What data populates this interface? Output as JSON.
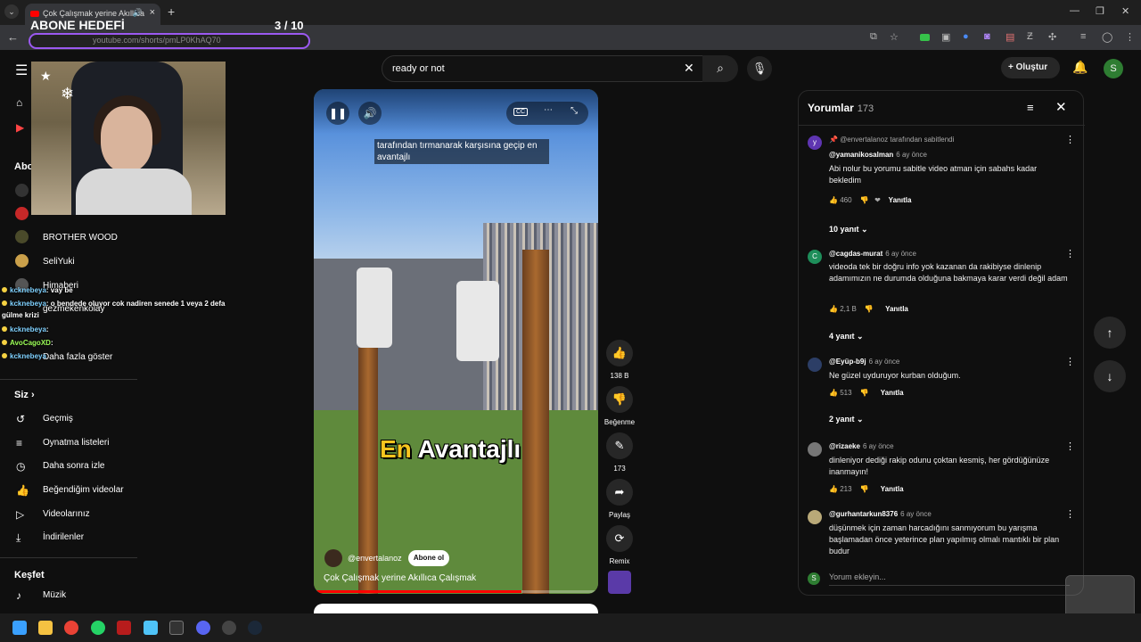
{
  "browser": {
    "tab_title": "Çok Çalışmak yerine Akıllıca",
    "url": "youtube.com/shorts/pmLP0KhAQ70",
    "new_tab": "+"
  },
  "overlay": {
    "title": "ABONE HEDEFİ",
    "count": "3  / 10"
  },
  "header": {
    "search_value": "ready or not",
    "create_label": "Oluştur",
    "avatar_letter": "S"
  },
  "sidebar": {
    "abo_label": "Abo",
    "channels": [
      "BROTHER WOOD",
      "SeliYuki",
      "Himaberi",
      "gezmekenkolay"
    ],
    "more_label": "Daha fazla göster",
    "you_label": "Siz",
    "you_items": [
      "Geçmiş",
      "Oynatma listeleri",
      "Daha sonra izle",
      "Beğendiğim videolar",
      "Videolarınız",
      "İndirilenler"
    ],
    "explore_label": "Keşfet",
    "explore_items": [
      "Müzik"
    ]
  },
  "chat": [
    {
      "user": "kcknebeya",
      "msg": ": vay be"
    },
    {
      "user": "kcknebeya",
      "msg": ": o bendede oluyor cok nadiren senede 1 veya 2 defa"
    },
    {
      "user": "",
      "msg": "gülme krizi"
    },
    {
      "user": "kcknebeya",
      "msg": ":"
    },
    {
      "user": "AvoCagoXD",
      "msg": ":"
    },
    {
      "user": "kcknebeya",
      "msg": ""
    }
  ],
  "video": {
    "caption": "tarafından tırmanarak karşısına geçip en avantajlı",
    "big_text_1": "En",
    "big_text_2": "Avantajlı",
    "channel": "@envertalanoz",
    "subscribe": "Abone ol",
    "title": "Çok Çalışmak yerine Akıllıca Çalışmak",
    "progress": 0.73,
    "cc": "CC"
  },
  "actions": {
    "likes": "138 B",
    "dislike": "Beğenme",
    "comments": "173",
    "share": "Paylaş",
    "remix": "Remix"
  },
  "comments": {
    "header": "Yorumlar",
    "count": "173",
    "pinned_note": "@envertalanoz tarafından sabitlendi",
    "reply_label": "Yanıtla",
    "input_placeholder": "Yorum ekleyin...",
    "items": [
      {
        "avatar": "y",
        "user": "@yamanikosalman",
        "time": "6 ay önce",
        "text": "Abi nolur bu yorumu sabitle video atman için sabahs kadar bekledim",
        "likes": "460",
        "replies": "10 yanıt"
      },
      {
        "avatar": "C",
        "user": "@cagdas-murat",
        "time": "6 ay önce",
        "text": "videoda tek bir doğru info yok kazanan da rakibiyse dinlenip adamımızın ne durumda olduğuna bakmaya karar verdi değil adam",
        "likes": "2,1 B",
        "replies": "4 yanıt"
      },
      {
        "avatar": "",
        "user": "@Eyüp-b9j",
        "time": "6 ay önce",
        "text": "Ne güzel uyduruyor kurban olduğum.",
        "likes": "513",
        "replies": "2 yanıt"
      },
      {
        "avatar": "",
        "user": "@rizaeke",
        "time": "6 ay önce",
        "text": "dinleniyor dediği rakip odunu çoktan kesmiş, her gördüğünüze inanmayın!",
        "likes": "213",
        "replies": ""
      },
      {
        "avatar": "",
        "user": "@gurhantarkun8376",
        "time": "6 ay önce",
        "text": "düşünmek için zaman harcadığını sanmıyorum bu yarışma başlamadan önce yeterince plan yapılmış olmalı mantıklı bir plan budur",
        "likes": "",
        "replies": ""
      }
    ]
  },
  "colors": {
    "accent": "#ff0000",
    "overlay_border": "#9b59f0",
    "subtitle_yellow": "#f7c51e"
  },
  "icons": [
    "back-icon",
    "menu-icon",
    "search-icon",
    "mic-icon",
    "bell-icon",
    "home-icon",
    "shorts-icon",
    "pause-icon",
    "volume-icon",
    "more-icon",
    "fullscreen-icon",
    "like-icon",
    "dislike-icon",
    "comment-icon",
    "share-icon",
    "remix-icon",
    "sort-icon",
    "close-icon",
    "arrow-up-icon",
    "arrow-down-icon"
  ]
}
